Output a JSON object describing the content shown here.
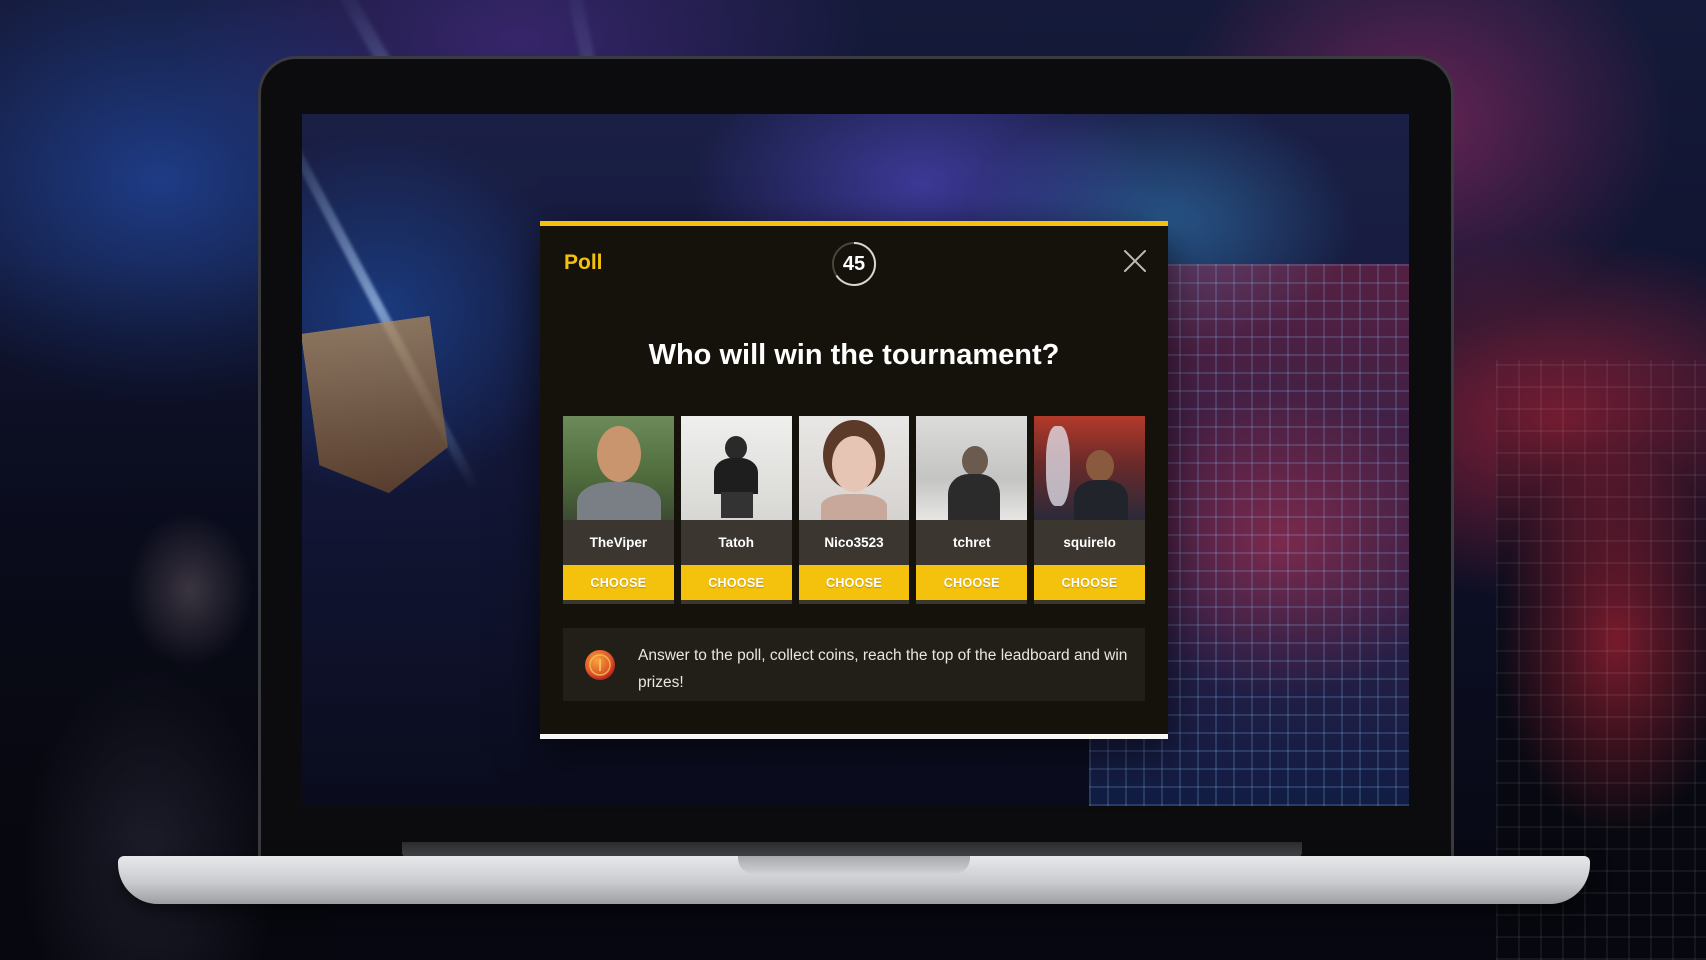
{
  "poll": {
    "label": "Poll",
    "timer": "45",
    "question": "Who will win the tournament?",
    "candidates": [
      {
        "name": "TheViper",
        "choose_label": "CHOOSE"
      },
      {
        "name": "Tatoh",
        "choose_label": "CHOOSE"
      },
      {
        "name": "Nico3523",
        "choose_label": "CHOOSE"
      },
      {
        "name": "tchret",
        "choose_label": "CHOOSE"
      },
      {
        "name": "squirelo",
        "choose_label": "CHOOSE"
      }
    ],
    "info_text": "Answer to the poll, collect coins, reach the top of the leadboard and win prizes!"
  },
  "colors": {
    "accent": "#f4c20d",
    "modal_bg": "#15120b",
    "card_bg": "#3b3730",
    "info_bg": "#221f18"
  },
  "icons": [
    "close-icon",
    "coin-icon",
    "timer-ring-icon"
  ]
}
